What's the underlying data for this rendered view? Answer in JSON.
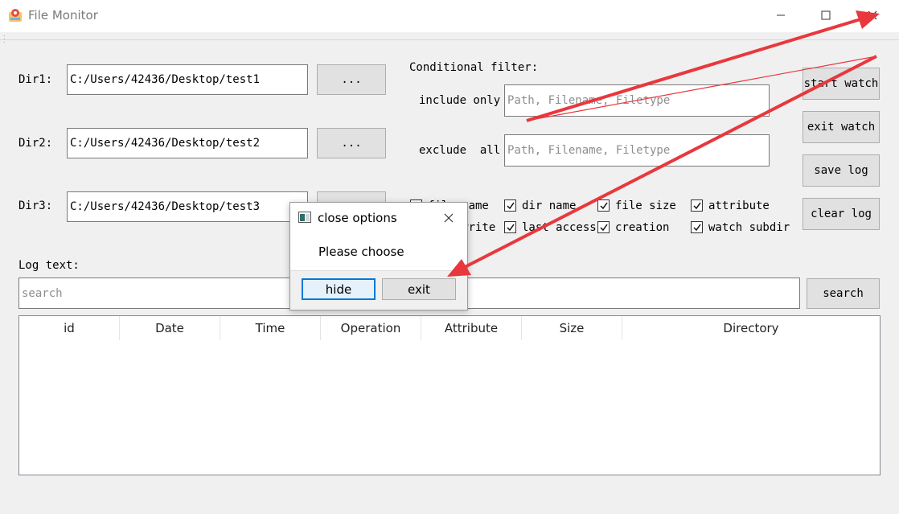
{
  "window": {
    "title": "File Monitor"
  },
  "dirs": [
    {
      "label": "Dir1:",
      "value": "C:/Users/42436/Desktop/test1",
      "browse_label": "..."
    },
    {
      "label": "Dir2:",
      "value": "C:/Users/42436/Desktop/test2",
      "browse_label": "..."
    },
    {
      "label": "Dir3:",
      "value": "C:/Users/42436/Desktop/test3",
      "browse_label": "..."
    }
  ],
  "filter": {
    "title": "Conditional filter:",
    "include_label": "include only",
    "include_placeholder": "Path, Filename, Filetype",
    "exclude_label": "exclude  all",
    "exclude_placeholder": "Path, Filename, Filetype"
  },
  "checkboxes": [
    {
      "label": "file name",
      "checked": true
    },
    {
      "label": "dir name",
      "checked": true
    },
    {
      "label": "file size",
      "checked": true
    },
    {
      "label": "attribute",
      "checked": true
    },
    {
      "label": "last write",
      "checked": true
    },
    {
      "label": "last access",
      "checked": true
    },
    {
      "label": "creation",
      "checked": true
    },
    {
      "label": "watch subdir",
      "checked": true
    }
  ],
  "actions": {
    "start": "start watch",
    "exit": "exit watch",
    "save": "save log",
    "clear": "clear log"
  },
  "log": {
    "label": "Log text:",
    "search_placeholder": "search",
    "search_button": "search",
    "columns": [
      "id",
      "Date",
      "Time",
      "Operation",
      "Attribute",
      "Size",
      "Directory"
    ],
    "rows": []
  },
  "dialog": {
    "title": "close options",
    "message": "Please choose",
    "hide_label": "hide",
    "exit_label": "exit"
  },
  "colors": {
    "annotation_arrow": "#e8383d",
    "focus_border": "#0078d7"
  }
}
